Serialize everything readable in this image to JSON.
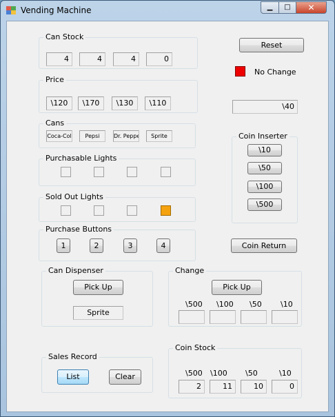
{
  "window": {
    "title": "Vending Machine",
    "minimize": "▁",
    "maximize": "□",
    "close": "✕"
  },
  "can_stock": {
    "label": "Can Stock",
    "values": [
      "4",
      "4",
      "4",
      "0"
    ]
  },
  "price": {
    "label": "Price",
    "values": [
      "\\120",
      "\\170",
      "\\130",
      "\\110"
    ]
  },
  "cans": {
    "label": "Cans",
    "names": [
      "Coca-Col",
      "Pepsi",
      "Dr. Peppe",
      "Sprite"
    ]
  },
  "purchasable_lights": {
    "label": "Purchasable Lights",
    "states": [
      false,
      false,
      false,
      false
    ]
  },
  "sold_out_lights": {
    "label": "Sold Out Lights",
    "states": [
      false,
      false,
      false,
      true
    ]
  },
  "purchase_buttons": {
    "label": "Purchase Buttons",
    "labels": [
      "1",
      "2",
      "3",
      "4"
    ]
  },
  "reset_button": "Reset",
  "no_change": {
    "label": "No Change",
    "color": "#ee0000"
  },
  "inserted_amount": "\\40",
  "coin_inserter": {
    "label": "Coin Inserter",
    "coins": [
      "\\10",
      "\\50",
      "\\100",
      "\\500"
    ]
  },
  "coin_return_button": "Coin Return",
  "can_dispenser": {
    "label": "Can Dispenser",
    "pickup": "Pick Up",
    "item": "Sprite"
  },
  "change": {
    "label": "Change",
    "pickup": "Pick Up",
    "denominations": [
      "\\500",
      "\\100",
      "\\50",
      "\\10"
    ],
    "values": [
      "",
      "",
      "",
      ""
    ]
  },
  "sales_record": {
    "label": "Sales Record",
    "list": "List",
    "clear": "Clear"
  },
  "coin_stock": {
    "label": "Coin Stock",
    "denominations": [
      "\\500",
      "\\100",
      "\\50",
      "\\10"
    ],
    "values": [
      "2",
      "11",
      "10",
      "0"
    ]
  },
  "colors": {
    "sold_out_on": "#f5a20f",
    "no_change_indicator": "#ee0000"
  }
}
